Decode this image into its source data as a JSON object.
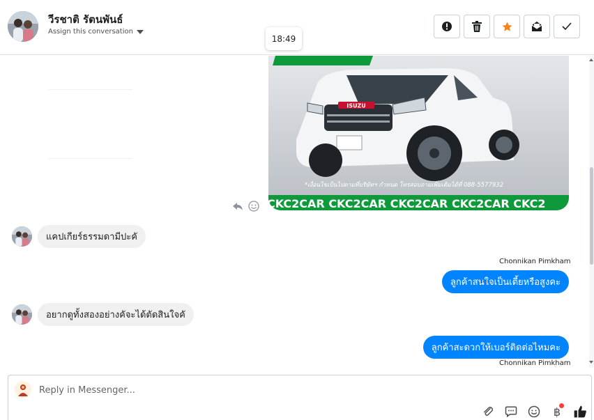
{
  "header": {
    "contact_name": "วีรชาติ รัตนพันธ์",
    "assign_label": "Assign this conversation",
    "tooltip_time": "18:49",
    "actions": [
      {
        "name": "mark-spam",
        "icon": "alert-circle-icon"
      },
      {
        "name": "delete",
        "icon": "trash-icon"
      },
      {
        "name": "star",
        "icon": "star-icon"
      },
      {
        "name": "mark-unread",
        "icon": "envelope-open-icon"
      },
      {
        "name": "mark-done",
        "icon": "check-icon"
      }
    ]
  },
  "thread": {
    "image": {
      "brand": "ISUZU",
      "banner_text": "CKC2CAR CKC2CAR CKC2CAR CKC2CAR CKC2",
      "caption": "*เงื่อนไขเป็นไปตามที่บริษัทฯ กำหนด โทรสอบถามเพิ่มเติมได้ที่ 088-5577932"
    },
    "messages": [
      {
        "direction": "in",
        "text": "แคปเกียร์ธรรมดามีปะคั"
      },
      {
        "direction": "out",
        "sender": "Chonnikan Pimkham",
        "text": "ลูกค้าสนใจเป็นเตี้ยหรือสูงคะ"
      },
      {
        "direction": "in",
        "text": "อยากดูทั้งสองอย่างคัจะได้ตัดสินใจคั"
      },
      {
        "direction": "out",
        "sender": "Chonnikan Pimkham",
        "text": "ลูกค้าสะดวกให้เบอร์ติดต่อไหมคะ"
      }
    ]
  },
  "composer": {
    "placeholder": "Reply in Messenger...",
    "tools": [
      "paperclip-icon",
      "quick-reply-icon",
      "emoji-icon",
      "baht-payment-icon",
      "like-icon"
    ],
    "baht_symbol": "฿"
  },
  "colors": {
    "accent_blue": "#0084ff",
    "incoming_bubble": "#f1f0f0",
    "star_orange": "#f5821f",
    "notification_red": "#fa3e3e"
  }
}
